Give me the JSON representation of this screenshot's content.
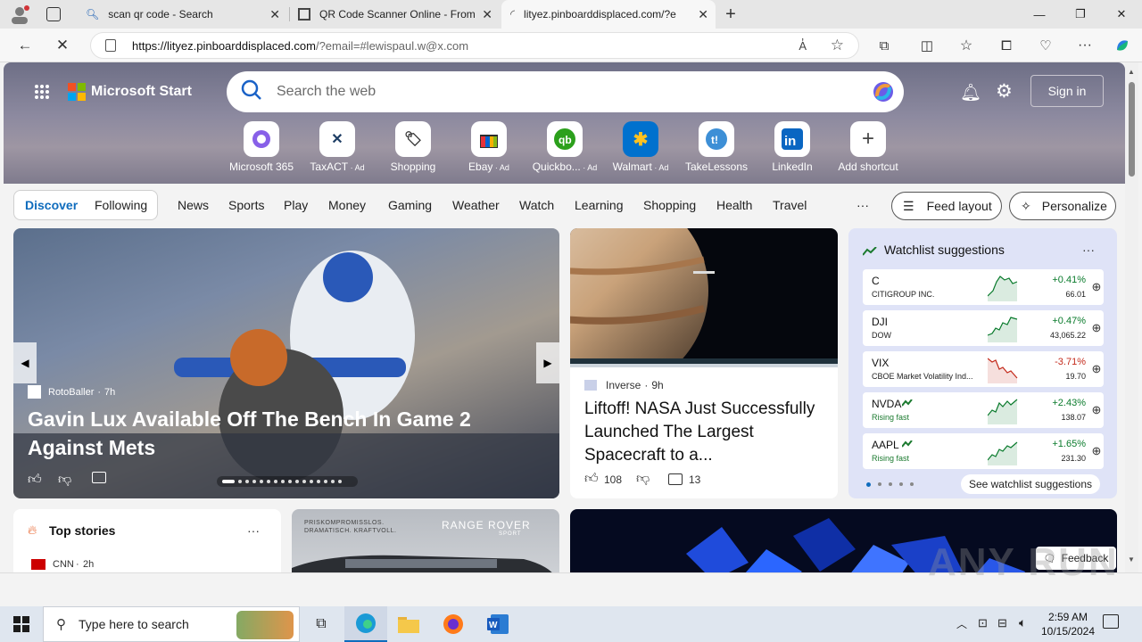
{
  "browser": {
    "tabs": [
      {
        "title": "scan qr code - Search"
      },
      {
        "title": "QR Code Scanner Online - From"
      },
      {
        "title": "lityez.pinboarddisplaced.com/?e"
      }
    ],
    "url_host": "https://lityez.pinboarddisplaced.com",
    "url_rest": "/?email=#lewispaul.w@x.com"
  },
  "msn": {
    "brand": "Microsoft Start",
    "search_placeholder": "Search the web",
    "sign_in": "Sign in",
    "shortcuts": [
      {
        "label": "Microsoft 365",
        "ad": ""
      },
      {
        "label": "TaxACT",
        "ad": "Ad"
      },
      {
        "label": "Shopping",
        "ad": ""
      },
      {
        "label": "Ebay",
        "ad": "Ad"
      },
      {
        "label": "Quickbo...",
        "ad": "Ad"
      },
      {
        "label": "Walmart",
        "ad": "Ad"
      },
      {
        "label": "TakeLessons",
        "ad": ""
      },
      {
        "label": "LinkedIn",
        "ad": ""
      },
      {
        "label": "Add shortcut",
        "ad": ""
      }
    ],
    "discover": "Discover",
    "following": "Following",
    "nav": [
      "News",
      "Sports",
      "Play",
      "Money",
      "Gaming",
      "Weather",
      "Watch",
      "Learning",
      "Shopping",
      "Health",
      "Travel"
    ],
    "more": "···",
    "feed_layout": "Feed layout",
    "personalize": "Personalize",
    "hero_story": {
      "source": "RotoBaller",
      "age": "7h",
      "title": "Gavin Lux Available Off The Bench In Game 2 Against Mets"
    },
    "nasa_story": {
      "source": "Inverse",
      "age": "9h",
      "title": "Liftoff! NASA Just Successfully Launched The Largest Spacecraft to a...",
      "likes": "108",
      "comments": "13"
    },
    "watchlist": {
      "title": "Watchlist suggestions",
      "more": "···",
      "see_more": "See watchlist suggestions",
      "stocks": [
        {
          "symbol": "C",
          "name": "CITIGROUP INC.",
          "change": "+0.41%",
          "price": "66.01",
          "trend": "up"
        },
        {
          "symbol": "DJI",
          "name": "DOW",
          "change": "+0.47%",
          "price": "43,065.22",
          "trend": "up"
        },
        {
          "symbol": "VIX",
          "name": "CBOE Market Volatility Ind...",
          "change": "-3.71%",
          "price": "19.70",
          "trend": "down"
        },
        {
          "symbol": "NVDA",
          "name": "Rising fast",
          "change": "+2.43%",
          "price": "138.07",
          "trend": "up"
        },
        {
          "symbol": "AAPL",
          "name": "Rising fast",
          "change": "+1.65%",
          "price": "231.30",
          "trend": "up"
        }
      ]
    },
    "top_stories": {
      "title": "Top stories",
      "more": "···",
      "first_source": "CNN",
      "first_age": "2h"
    },
    "ad": {
      "line1": "PRISKOMPROMISSLOS.",
      "line2": "DRAMATISCH. KRAFTVOLL.",
      "brand": "RANGE ROVER",
      "sub": "SPORT"
    },
    "feedback": "Feedback"
  },
  "taskbar": {
    "search_placeholder": "Type here to search",
    "time": "2:59 AM",
    "date": "10/15/2024"
  },
  "watermark": "ANY RUN",
  "colors": {
    "accent": "#0f6cbd",
    "up": "#0a7b2c",
    "down": "#c42b1c"
  }
}
